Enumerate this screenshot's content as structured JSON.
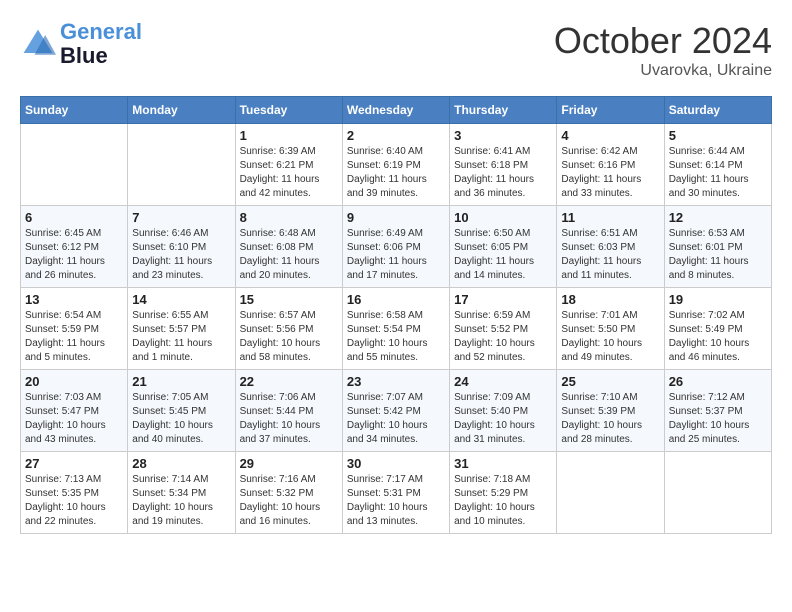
{
  "header": {
    "logo_line1": "General",
    "logo_line2": "Blue",
    "month_title": "October 2024",
    "location": "Uvarovka, Ukraine"
  },
  "weekdays": [
    "Sunday",
    "Monday",
    "Tuesday",
    "Wednesday",
    "Thursday",
    "Friday",
    "Saturday"
  ],
  "weeks": [
    [
      {
        "day": "",
        "info": ""
      },
      {
        "day": "",
        "info": ""
      },
      {
        "day": "1",
        "info": "Sunrise: 6:39 AM\nSunset: 6:21 PM\nDaylight: 11 hours and 42 minutes."
      },
      {
        "day": "2",
        "info": "Sunrise: 6:40 AM\nSunset: 6:19 PM\nDaylight: 11 hours and 39 minutes."
      },
      {
        "day": "3",
        "info": "Sunrise: 6:41 AM\nSunset: 6:18 PM\nDaylight: 11 hours and 36 minutes."
      },
      {
        "day": "4",
        "info": "Sunrise: 6:42 AM\nSunset: 6:16 PM\nDaylight: 11 hours and 33 minutes."
      },
      {
        "day": "5",
        "info": "Sunrise: 6:44 AM\nSunset: 6:14 PM\nDaylight: 11 hours and 30 minutes."
      }
    ],
    [
      {
        "day": "6",
        "info": "Sunrise: 6:45 AM\nSunset: 6:12 PM\nDaylight: 11 hours and 26 minutes."
      },
      {
        "day": "7",
        "info": "Sunrise: 6:46 AM\nSunset: 6:10 PM\nDaylight: 11 hours and 23 minutes."
      },
      {
        "day": "8",
        "info": "Sunrise: 6:48 AM\nSunset: 6:08 PM\nDaylight: 11 hours and 20 minutes."
      },
      {
        "day": "9",
        "info": "Sunrise: 6:49 AM\nSunset: 6:06 PM\nDaylight: 11 hours and 17 minutes."
      },
      {
        "day": "10",
        "info": "Sunrise: 6:50 AM\nSunset: 6:05 PM\nDaylight: 11 hours and 14 minutes."
      },
      {
        "day": "11",
        "info": "Sunrise: 6:51 AM\nSunset: 6:03 PM\nDaylight: 11 hours and 11 minutes."
      },
      {
        "day": "12",
        "info": "Sunrise: 6:53 AM\nSunset: 6:01 PM\nDaylight: 11 hours and 8 minutes."
      }
    ],
    [
      {
        "day": "13",
        "info": "Sunrise: 6:54 AM\nSunset: 5:59 PM\nDaylight: 11 hours and 5 minutes."
      },
      {
        "day": "14",
        "info": "Sunrise: 6:55 AM\nSunset: 5:57 PM\nDaylight: 11 hours and 1 minute."
      },
      {
        "day": "15",
        "info": "Sunrise: 6:57 AM\nSunset: 5:56 PM\nDaylight: 10 hours and 58 minutes."
      },
      {
        "day": "16",
        "info": "Sunrise: 6:58 AM\nSunset: 5:54 PM\nDaylight: 10 hours and 55 minutes."
      },
      {
        "day": "17",
        "info": "Sunrise: 6:59 AM\nSunset: 5:52 PM\nDaylight: 10 hours and 52 minutes."
      },
      {
        "day": "18",
        "info": "Sunrise: 7:01 AM\nSunset: 5:50 PM\nDaylight: 10 hours and 49 minutes."
      },
      {
        "day": "19",
        "info": "Sunrise: 7:02 AM\nSunset: 5:49 PM\nDaylight: 10 hours and 46 minutes."
      }
    ],
    [
      {
        "day": "20",
        "info": "Sunrise: 7:03 AM\nSunset: 5:47 PM\nDaylight: 10 hours and 43 minutes."
      },
      {
        "day": "21",
        "info": "Sunrise: 7:05 AM\nSunset: 5:45 PM\nDaylight: 10 hours and 40 minutes."
      },
      {
        "day": "22",
        "info": "Sunrise: 7:06 AM\nSunset: 5:44 PM\nDaylight: 10 hours and 37 minutes."
      },
      {
        "day": "23",
        "info": "Sunrise: 7:07 AM\nSunset: 5:42 PM\nDaylight: 10 hours and 34 minutes."
      },
      {
        "day": "24",
        "info": "Sunrise: 7:09 AM\nSunset: 5:40 PM\nDaylight: 10 hours and 31 minutes."
      },
      {
        "day": "25",
        "info": "Sunrise: 7:10 AM\nSunset: 5:39 PM\nDaylight: 10 hours and 28 minutes."
      },
      {
        "day": "26",
        "info": "Sunrise: 7:12 AM\nSunset: 5:37 PM\nDaylight: 10 hours and 25 minutes."
      }
    ],
    [
      {
        "day": "27",
        "info": "Sunrise: 7:13 AM\nSunset: 5:35 PM\nDaylight: 10 hours and 22 minutes."
      },
      {
        "day": "28",
        "info": "Sunrise: 7:14 AM\nSunset: 5:34 PM\nDaylight: 10 hours and 19 minutes."
      },
      {
        "day": "29",
        "info": "Sunrise: 7:16 AM\nSunset: 5:32 PM\nDaylight: 10 hours and 16 minutes."
      },
      {
        "day": "30",
        "info": "Sunrise: 7:17 AM\nSunset: 5:31 PM\nDaylight: 10 hours and 13 minutes."
      },
      {
        "day": "31",
        "info": "Sunrise: 7:18 AM\nSunset: 5:29 PM\nDaylight: 10 hours and 10 minutes."
      },
      {
        "day": "",
        "info": ""
      },
      {
        "day": "",
        "info": ""
      }
    ]
  ]
}
